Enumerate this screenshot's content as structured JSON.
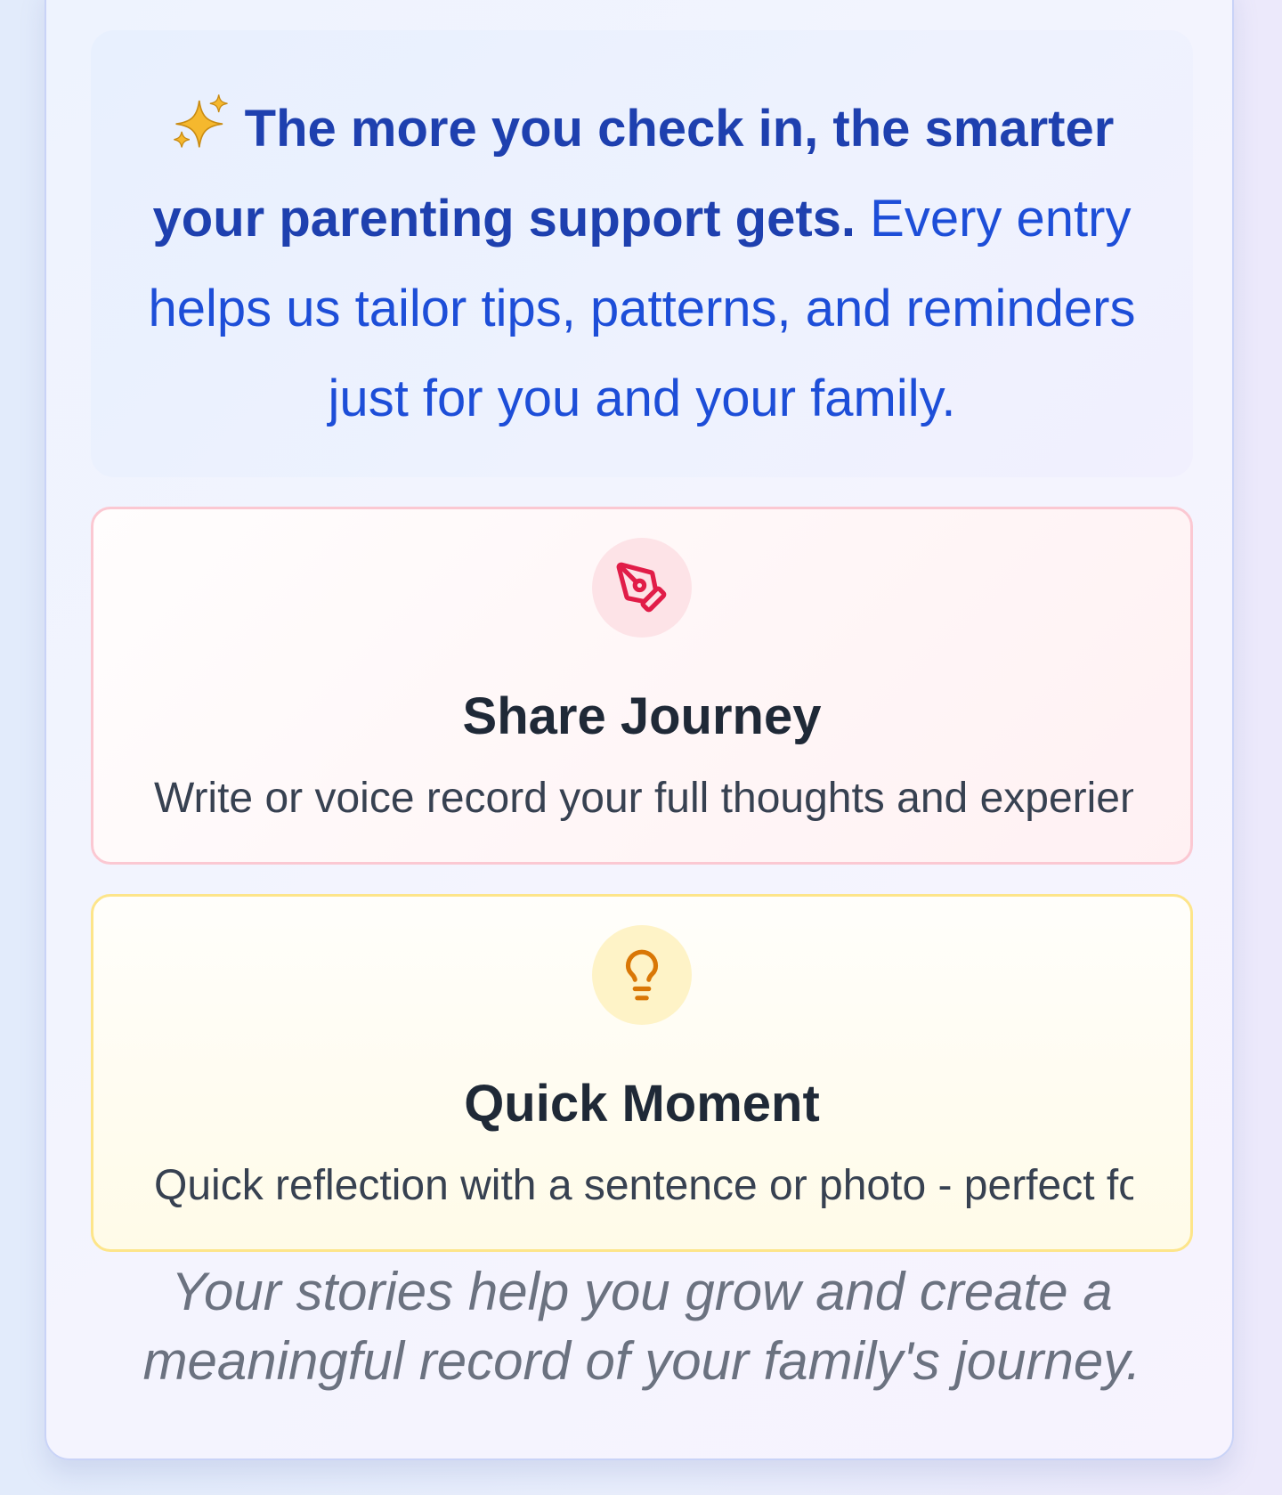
{
  "info": {
    "sparkle_icon": "sparkles",
    "lead": "The more you check in, the smarter your parenting support gets.",
    "body": " Every entry helps us tailor tips, patterns, and reminders just for you and your family."
  },
  "options": [
    {
      "icon": "pen-tool-icon",
      "title": "Share Journey",
      "description": "Write or voice record your full thoughts and experiences",
      "accent": "#e11d48"
    },
    {
      "icon": "lightbulb-icon",
      "title": "Quick Moment",
      "description": "Quick reflection with a sentence or photo - perfect for busy days",
      "accent": "#d97706"
    }
  ],
  "footer": {
    "note": "Your stories help you grow and create a meaningful record of your family's journey."
  }
}
